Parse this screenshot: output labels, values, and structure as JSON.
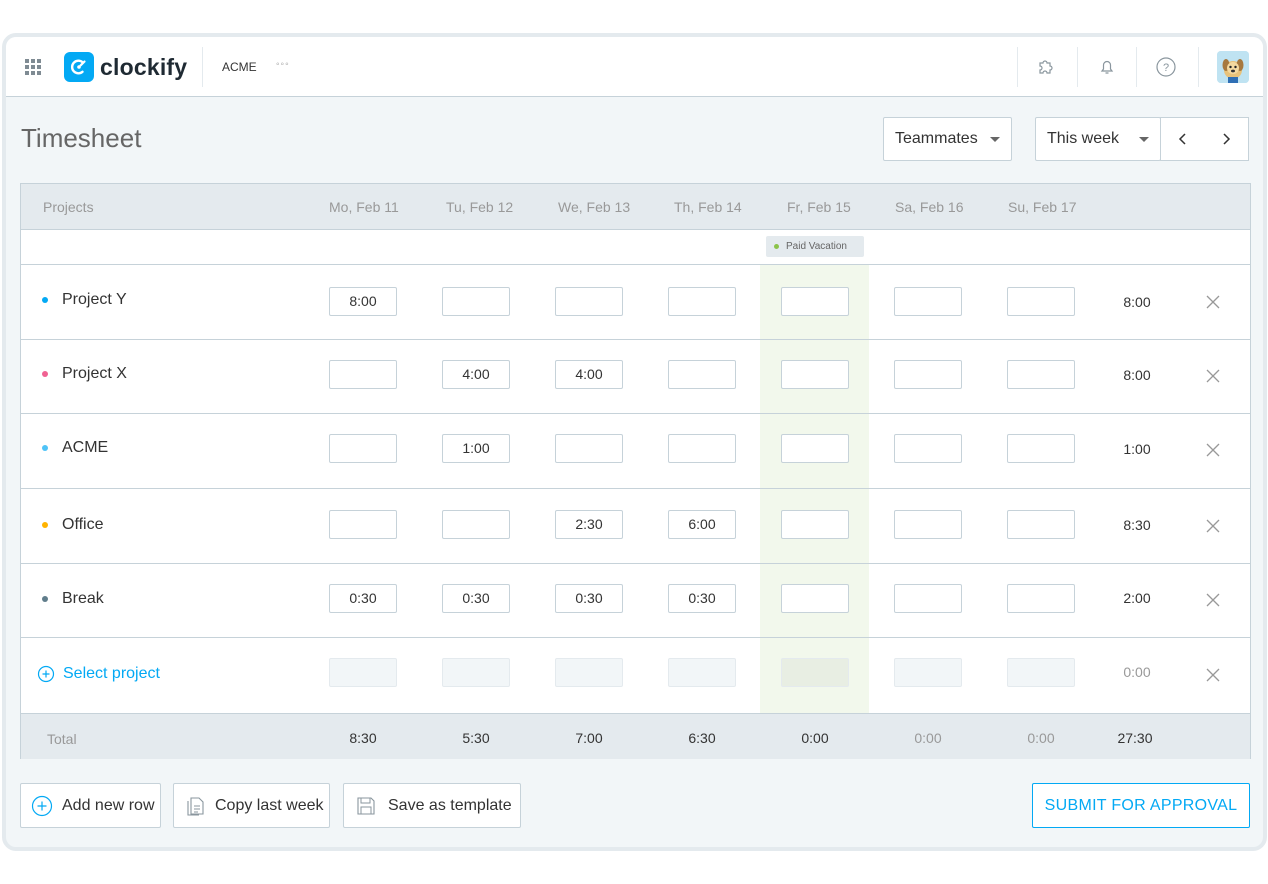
{
  "app": {
    "logo_text": "clockify",
    "workspace": "ACME",
    "more_dots": "◦◦◦",
    "icons": [
      "apps-grid-icon",
      "integrations-puzzle-icon",
      "notifications-bell-icon",
      "help-icon",
      "user-avatar"
    ]
  },
  "page": {
    "title": "Timesheet",
    "teammates_label": "Teammates",
    "range_label": "This week"
  },
  "table": {
    "projects_header": "Projects",
    "days": [
      "Mo, Feb 11",
      "Tu, Feb 12",
      "We, Feb 13",
      "Th, Feb 14",
      "Fr, Feb 15",
      "Sa, Feb 16",
      "Su, Feb 17"
    ],
    "vacation_badge": "Paid Vacation",
    "rows": [
      {
        "name": "Project Y",
        "color": "#03a9f4",
        "cells": [
          "8:00",
          "",
          "",
          "",
          "",
          "",
          ""
        ],
        "total": "8:00"
      },
      {
        "name": "Project X",
        "color": "#f06292",
        "cells": [
          "",
          "4:00",
          "4:00",
          "",
          "",
          "",
          ""
        ],
        "total": "8:00"
      },
      {
        "name": "ACME",
        "color": "#4fc3f7",
        "cells": [
          "",
          "1:00",
          "",
          "",
          "",
          "",
          ""
        ],
        "total": "1:00"
      },
      {
        "name": "Office",
        "color": "#ffb300",
        "cells": [
          "",
          "",
          "2:30",
          "6:00",
          "",
          "",
          ""
        ],
        "total": "8:30"
      },
      {
        "name": "Break",
        "color": "#607d8b",
        "cells": [
          "0:30",
          "0:30",
          "0:30",
          "0:30",
          "",
          "",
          ""
        ],
        "total": "2:00"
      }
    ],
    "select_project_label": "Select project",
    "select_project_total": "0:00",
    "total_label": "Total",
    "day_totals": [
      "8:30",
      "5:30",
      "7:00",
      "6:30",
      "0:00",
      "0:00",
      "0:00"
    ],
    "grand_total": "27:30"
  },
  "actions": {
    "add_row": "Add new row",
    "copy_week": "Copy last week",
    "save_template": "Save as template",
    "submit": "SUBMIT FOR APPROVAL"
  },
  "colors": {
    "accent": "#03a9f4",
    "vacation_highlight": "#f2f8ec",
    "vacation_dot": "#8bc34a"
  }
}
